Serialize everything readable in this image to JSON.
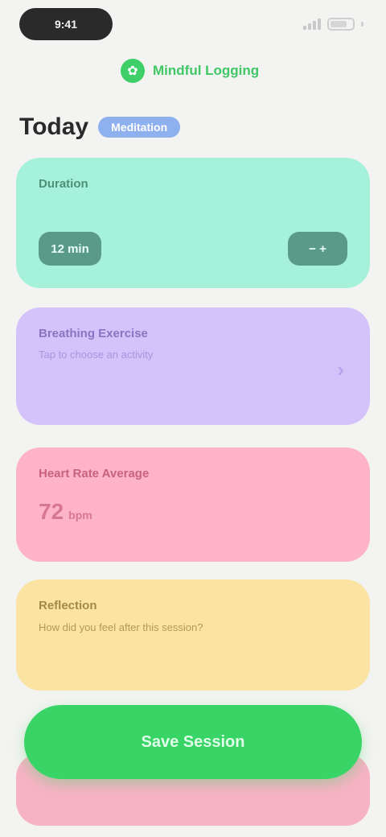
{
  "status": {
    "time": "9:41"
  },
  "session": {
    "label": "Mindful Logging"
  },
  "header": {
    "title": "Today",
    "chip": "Meditation"
  },
  "cards": {
    "duration": {
      "label": "Duration",
      "value": "12 min",
      "stepper": "− +"
    },
    "activity": {
      "label": "Breathing Exercise",
      "sub": "Tap to choose an activity",
      "chevron": "›"
    },
    "heart": {
      "label": "Heart Rate Average",
      "value": "72",
      "unit": "bpm"
    },
    "notes": {
      "label": "Reflection",
      "sub": "How did you feel after this session?"
    }
  },
  "actions": {
    "save": "Save Session"
  },
  "colors": {
    "accent_green": "#38d466",
    "mint": "#a6f1d9",
    "lilac": "#d4c3fb",
    "pink": "#ffb3c8",
    "yellow": "#fbe3a4"
  }
}
